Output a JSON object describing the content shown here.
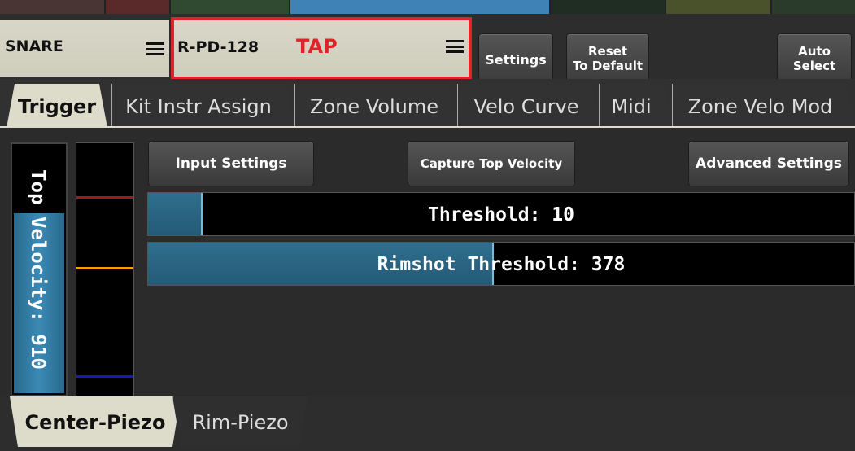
{
  "header": {
    "kit_name": "SNARE",
    "pad_name": "R-PD-128",
    "mode_label": "TAP",
    "settings_label": "Settings",
    "reset_line1": "Reset",
    "reset_line2": "To Default",
    "auto_line1": "Auto",
    "auto_line2": "Select"
  },
  "tabs": [
    {
      "label": "Trigger",
      "active": true
    },
    {
      "label": "Kit Instr Assign",
      "active": false
    },
    {
      "label": "Zone Volume",
      "active": false
    },
    {
      "label": "Velo Curve",
      "active": false
    },
    {
      "label": "Midi",
      "active": false
    },
    {
      "label": "Zone Velo Mod",
      "active": false
    }
  ],
  "main": {
    "top_velocity_label": "Top Velocity: 910",
    "top_velocity_value": 910,
    "top_velocity_fill_fraction": 0.73,
    "input_settings_label": "Input Settings",
    "capture_label": "Capture Top Velocity",
    "advanced_label": "Advanced Settings",
    "threshold_label": "Threshold: 10",
    "threshold_fill_fraction": 0.077,
    "rimshot_label": "Rimshot Threshold: 378",
    "rimshot_fill_fraction": 0.49,
    "level_markers": [
      {
        "name": "red",
        "color": "#9a1a1f",
        "fraction": 0.21
      },
      {
        "name": "orange",
        "color": "#f2a100",
        "fraction": 0.49
      },
      {
        "name": "blue",
        "color": "#1a1aa8",
        "fraction": 0.92
      }
    ]
  },
  "bottom_tabs": [
    {
      "label": "Center-Piezo",
      "active": true
    },
    {
      "label": "Rim-Piezo",
      "active": false
    }
  ],
  "colors": {
    "accent_red": "#e0232a",
    "active_tab": "#dddccb",
    "fill_blue": "#2f6f8f"
  }
}
